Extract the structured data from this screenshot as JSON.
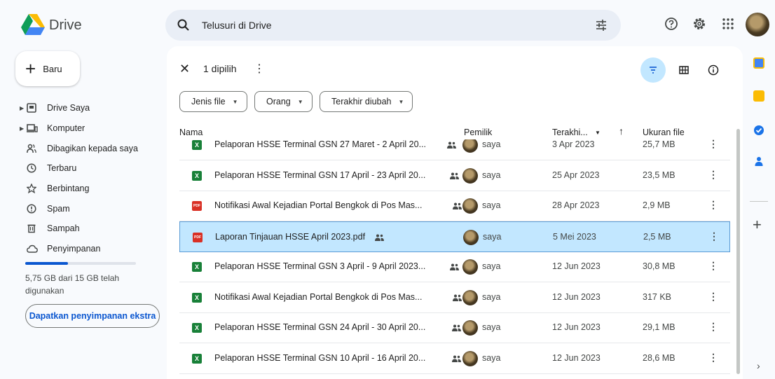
{
  "app": {
    "name": "Drive"
  },
  "search": {
    "placeholder": "Telusuri di Drive"
  },
  "new_button": {
    "label": "Baru"
  },
  "nav": {
    "items": [
      {
        "label": "Drive Saya",
        "icon": "my-drive-icon",
        "expandable": true
      },
      {
        "label": "Komputer",
        "icon": "computer-icon",
        "expandable": true
      },
      {
        "label": "Dibagikan kepada saya",
        "icon": "shared-icon",
        "expandable": false
      },
      {
        "label": "Terbaru",
        "icon": "clock-icon",
        "expandable": false
      },
      {
        "label": "Berbintang",
        "icon": "star-icon",
        "expandable": false
      },
      {
        "label": "Spam",
        "icon": "spam-icon",
        "expandable": false
      },
      {
        "label": "Sampah",
        "icon": "trash-icon",
        "expandable": false
      },
      {
        "label": "Penyimpanan",
        "icon": "cloud-icon",
        "expandable": false
      }
    ]
  },
  "storage": {
    "text": "5,75 GB dari 15 GB telah digunakan",
    "used_fraction": 0.383,
    "cta": "Dapatkan penyimpanan ekstra"
  },
  "selection": {
    "count_label": "1 dipilih"
  },
  "filters": {
    "file_type": "Jenis file",
    "people": "Orang",
    "modified": "Terakhir diubah"
  },
  "table": {
    "col_name": "Nama",
    "col_owner": "Pemilik",
    "col_modified": "Terakhi...",
    "col_size": "Ukuran file"
  },
  "files": [
    {
      "type": "xls",
      "name": "Pelaporan HSSE Terminal GSN 27 Maret - 2 April 20...",
      "owner": "saya",
      "modified": "3 Apr 2023",
      "size": "25,7 MB",
      "selected": false
    },
    {
      "type": "xls",
      "name": "Pelaporan HSSE Terminal GSN 17 April - 23 April 20...",
      "owner": "saya",
      "modified": "25 Apr 2023",
      "size": "23,5 MB",
      "selected": false
    },
    {
      "type": "pdf",
      "name": "Notifikasi Awal Kejadian Portal Bengkok di Pos Mas...",
      "owner": "saya",
      "modified": "28 Apr 2023",
      "size": "2,9 MB",
      "selected": false
    },
    {
      "type": "pdf",
      "name": "Laporan Tinjauan HSSE April 2023.pdf",
      "owner": "saya",
      "modified": "5 Mei 2023",
      "size": "2,5 MB",
      "selected": true
    },
    {
      "type": "xls",
      "name": "Pelaporan HSSE Terminal GSN 3 April - 9 April 2023...",
      "owner": "saya",
      "modified": "12 Jun 2023",
      "size": "30,8 MB",
      "selected": false
    },
    {
      "type": "xls",
      "name": "Notifikasi Awal Kejadian Portal Bengkok di Pos Mas...",
      "owner": "saya",
      "modified": "12 Jun 2023",
      "size": "317 KB",
      "selected": false
    },
    {
      "type": "xls",
      "name": "Pelaporan HSSE Terminal GSN 24 April - 30 April 20...",
      "owner": "saya",
      "modified": "12 Jun 2023",
      "size": "29,1 MB",
      "selected": false
    },
    {
      "type": "xls",
      "name": "Pelaporan HSSE Terminal GSN 10 April - 16 April 20...",
      "owner": "saya",
      "modified": "12 Jun 2023",
      "size": "28,6 MB",
      "selected": false
    }
  ],
  "colors": {
    "accent": "#0b57d0",
    "selected_row": "#c2e7ff",
    "sheet_green": "#188038",
    "pdf_red": "#d93025",
    "search_bg": "#e9eef6"
  }
}
